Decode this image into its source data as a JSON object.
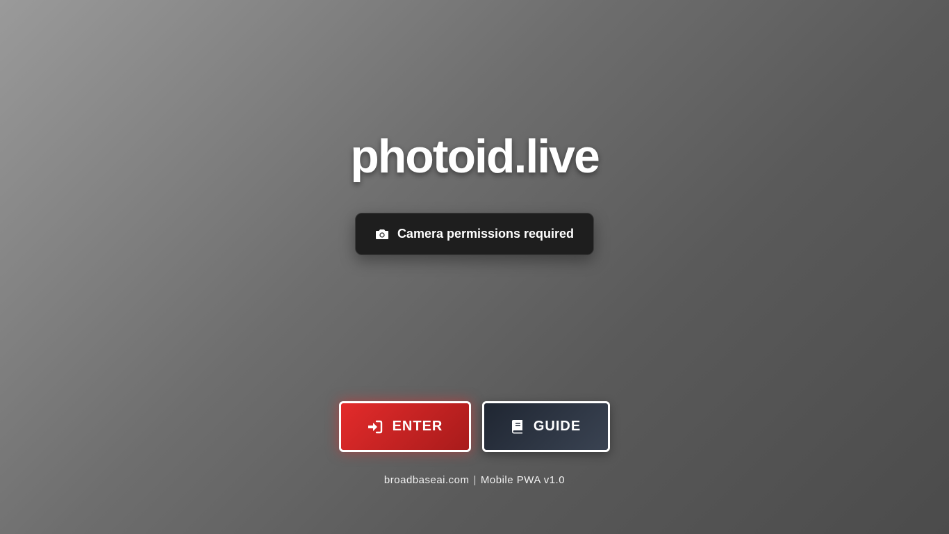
{
  "app": {
    "title": "photoid.live"
  },
  "status": {
    "icon": "camera-icon",
    "text": "Camera permissions required"
  },
  "actions": {
    "enter": {
      "label": "ENTER",
      "icon": "sign-in-icon",
      "color": "#d32626"
    },
    "guide": {
      "label": "GUIDE",
      "icon": "book-icon",
      "color": "#2a3240"
    }
  },
  "footer": {
    "site": "broadbaseai.com",
    "separator": "|",
    "version": "Mobile PWA v1.0"
  }
}
